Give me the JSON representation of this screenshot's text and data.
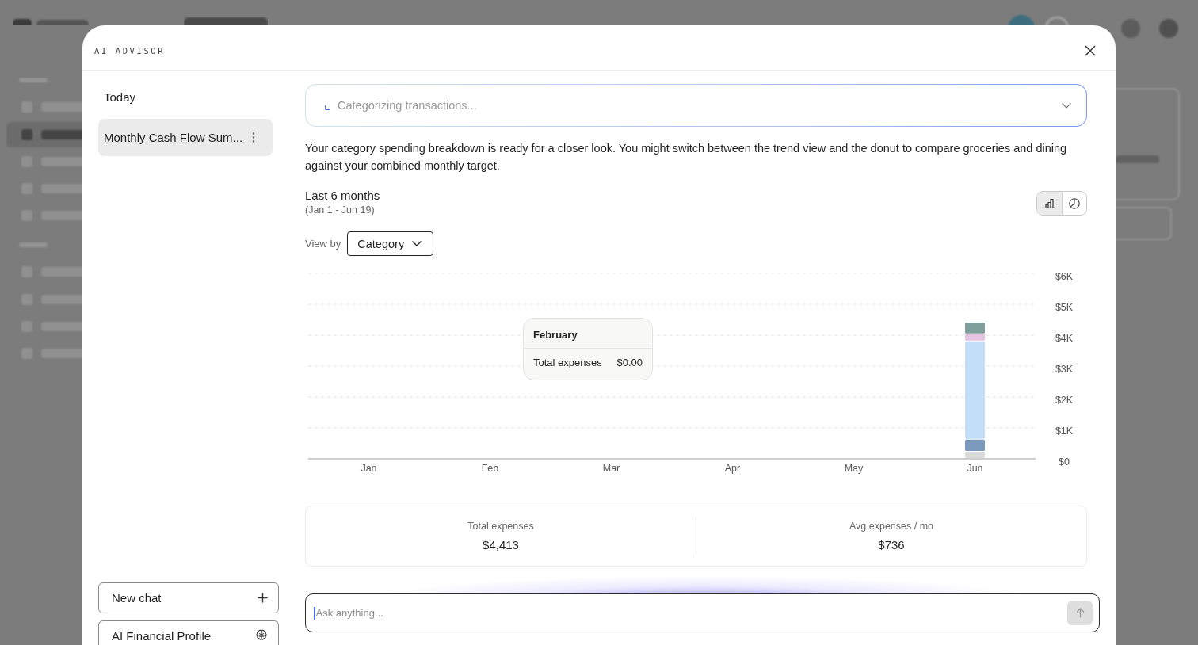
{
  "dialog": {
    "title": "AI ADVISOR"
  },
  "sidebar": {
    "sections": [
      {
        "label": "Today",
        "chats": [
          {
            "title": "Monthly Cash Flow Sum...",
            "selected": true
          }
        ]
      }
    ],
    "buttons": [
      {
        "kind": "new",
        "label": "New chat"
      },
      {
        "kind": "profile",
        "label": "AI Financial Profile"
      }
    ]
  },
  "status": {
    "text": "Categorizing transactions...",
    "loading": true,
    "expanded": false
  },
  "message": "Your category spending breakdown is ready for a closer look. You might switch between the trend view and the donut to compare groceries and dining against your combined monthly target.",
  "chart_panel": {
    "title": "Last 6 months",
    "subtitle": "(Jan 1 - Jun 19)",
    "view_toggle": [
      {
        "kind": "bar",
        "selected": true
      },
      {
        "kind": "pie",
        "selected": false
      }
    ],
    "view_by": {
      "label": "View by",
      "value": "Category"
    },
    "chart_data": {
      "type": "bar",
      "stacked": true,
      "grid": true,
      "categories": [
        "Jan",
        "Feb",
        "Mar",
        "Apr",
        "May",
        "Jun"
      ],
      "series": [
        {
          "color": "#dadada",
          "values": [
            0,
            0,
            0,
            0,
            0,
            230
          ]
        },
        {
          "color": "#7b98bd",
          "values": [
            0,
            0,
            0,
            0,
            0,
            390
          ]
        },
        {
          "color": "#c4e0f9",
          "values": [
            0,
            0,
            0,
            0,
            0,
            3180
          ]
        },
        {
          "color": "#e4c2e2",
          "values": [
            0,
            0,
            0,
            0,
            0,
            230
          ]
        },
        {
          "color": "#7f9f9c",
          "values": [
            0,
            0,
            0,
            0,
            0,
            380
          ]
        }
      ],
      "ylim": [
        0,
        6000
      ],
      "yticks": [
        {
          "value": 0,
          "label": "$0"
        },
        {
          "value": 1000,
          "label": "$1K"
        },
        {
          "value": 2000,
          "label": "$2K"
        },
        {
          "value": 3000,
          "label": "$3K"
        },
        {
          "value": 4000,
          "label": "$4K"
        },
        {
          "value": 5000,
          "label": "$5K"
        },
        {
          "value": 6000,
          "label": "$6K"
        }
      ]
    },
    "tooltip": {
      "title": "February",
      "label": "Total expenses",
      "value": "$0.00"
    }
  },
  "stats": [
    {
      "label": "Total expenses",
      "value": "$4,413"
    },
    {
      "label": "Avg expenses / mo",
      "value": "$736"
    }
  ],
  "composer": {
    "placeholder": "Ask anything...",
    "focused": true,
    "send_disabled": true
  }
}
